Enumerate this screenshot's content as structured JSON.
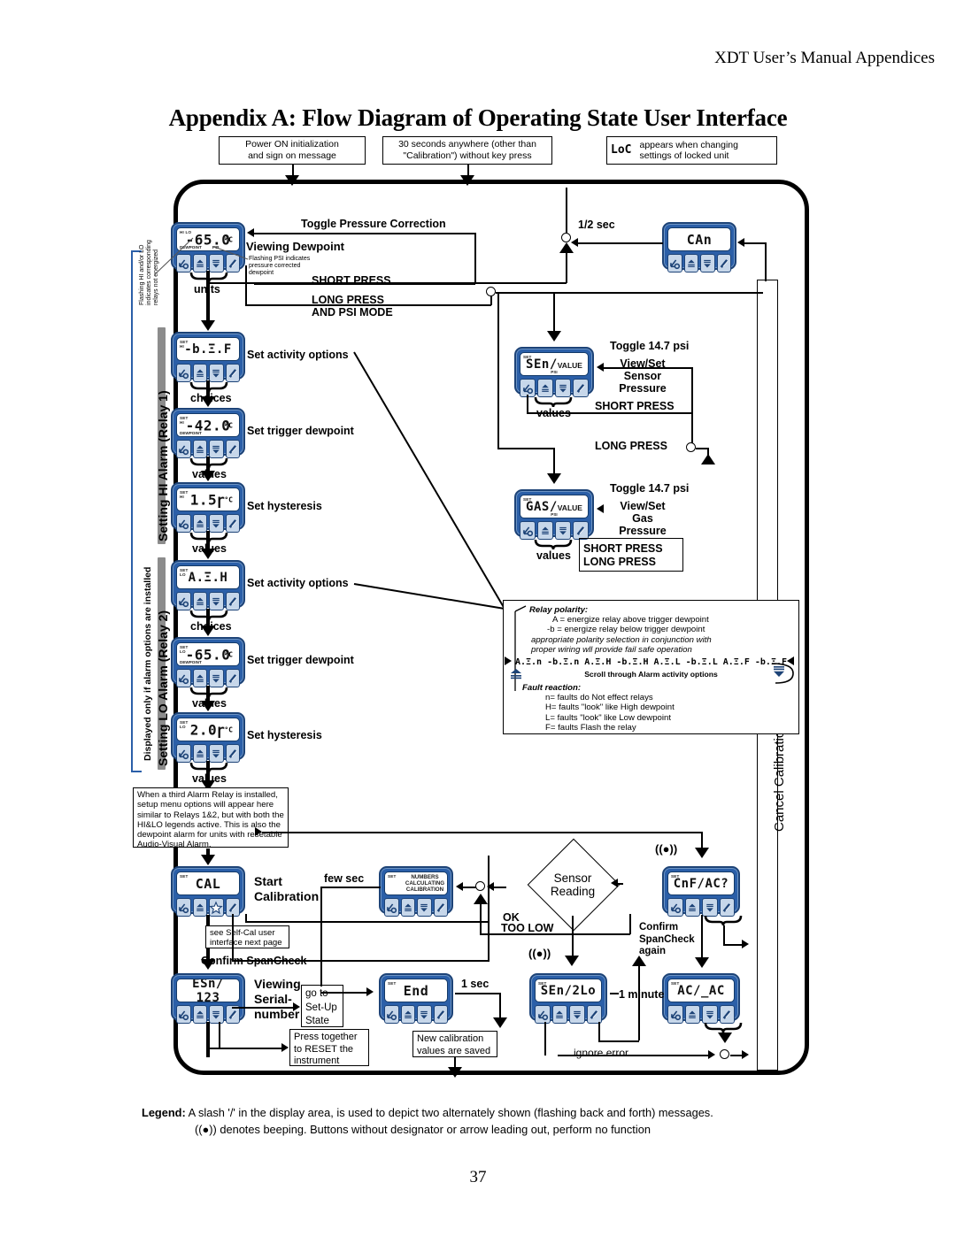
{
  "page": {
    "header": "XDT User’s Manual Appendices",
    "title": "Appendix A: Flow Diagram of Operating State User Interface",
    "number": "37"
  },
  "top_notes": {
    "power_on": "Power  ON initialization\nand sign on message",
    "timeout": "30 seconds anywhere (other than\n\"Calibration\") without key press",
    "locked_display": "LoC",
    "locked_text": "appears when changing\nsettings of locked unit"
  },
  "vertical_labels": {
    "installed": "Displayed only if alarm options are installed",
    "relay1": "Setting HI Alarm (Relay 1)",
    "relay2": "Setting LO Alarm (Relay 2)",
    "cancel_cal": "Cancel Calibration (it is not performed)",
    "flashing_note": "Flashing HI  and/or LO\nindicates corresponding\nrelays not energized"
  },
  "devices": {
    "dewpoint": {
      "tl": "HI LO",
      "bl": "DEWPOINT",
      "bc2": "PSI",
      "value": "-65.0",
      "unit": "°C"
    },
    "hi_activity": {
      "tl": "SET\nHI",
      "value": "-b.Ξ.F"
    },
    "hi_trigger": {
      "tl": "SET\nHI",
      "bl": "DEWPOINT",
      "value": "-42.0",
      "unit": "°C"
    },
    "hi_hyst": {
      "tl": "SET\nHI",
      "value": "1.5ɼ",
      "unit": "°C"
    },
    "lo_activity": {
      "tl": "SET\nLO",
      "value": "A.Ξ.H"
    },
    "lo_trigger": {
      "tl": "SET\nLO",
      "bl": "DEWPOINT",
      "value": "-65.0",
      "unit": "°C"
    },
    "lo_hyst": {
      "tl": "SET\nLO",
      "value": "2.0ɼ",
      "unit": "°C"
    },
    "can": {
      "value": "CAn"
    },
    "sen_value": {
      "tl": "SET",
      "bc": "PSI",
      "value": "SEn/",
      "suffix": "VALUE"
    },
    "gas_value": {
      "tl": "SET",
      "bc": "PSI",
      "value": "GAS/",
      "suffix": "VALUE"
    },
    "cal": {
      "tl": "SET",
      "value": "CAL"
    },
    "numbers": {
      "tl": "SET",
      "multi": "NUMBERS\nCALCULATING\nCALIBRATION"
    },
    "esn": {
      "value": "ESn/ 123"
    },
    "end": {
      "tl": "SET",
      "value": "End"
    },
    "sen2lo": {
      "tl": "SET",
      "value": "SEn/2Lo"
    },
    "cnf": {
      "tl": "SET",
      "value": "CnF/AC?"
    },
    "ac": {
      "tl": "SET",
      "value": "AC/_AC"
    }
  },
  "annotations": {
    "toggle_pressure": "Toggle Pressure Correction",
    "viewing_dewpoint": "Viewing Dewpoint",
    "flashing_psi": "Flashing PSI indicates\npressure corrected\ndewpoint",
    "short_press": "SHORT PRESS",
    "long_press_psi": "LONG PRESS\nAND PSI MODE",
    "units": "units",
    "choices": "choices",
    "values": "values",
    "set_activity": "Set activity options",
    "set_trigger": "Set trigger dewpoint",
    "set_hysteresis": "Set hysteresis",
    "half_sec": "1/2 sec",
    "toggle_147": "Toggle 14.7 psi",
    "view_set_sensor": "View/Set\nSensor\nPressure",
    "view_set_gas": "View/Set\nGas\nPressure",
    "long_press": "LONG PRESS",
    "third_relay": "When a third Alarm Relay is installed, setup menu options will appear here similar to Relays 1&2, but with both the HI&LO legends active. This is also the dewpoint alarm for units with resetable Audio-Visual Alarm.",
    "start_calibration": "Start\nCalibration",
    "self_cal": "see Self-Cal user\ninterface next page",
    "confirm_spancheck": "Confirm SpanCheck",
    "confirm_spancheck_again": "Confirm\nSpanCheck\nagain",
    "few_sec": "few sec",
    "ok": "OK",
    "too_low": "TOO LOW",
    "sensor_reading": "Sensor\nReading",
    "viewing_serial": "Viewing\nSerial-\nnumber",
    "goto_setup": "go to\nSet-Up\nState",
    "press_reset": "Press together\nto RESET the\ninstrument",
    "one_sec": "1 sec",
    "new_cal_saved": "New calibration\nvalues are saved",
    "one_minute": "1 minute",
    "ignore_error": "ignore error"
  },
  "relay_legend": {
    "polarity_title": "Relay polarity:",
    "polarity_a": "A = energize relay above trigger dewpoint",
    "polarity_b": "-b = energize relay below trigger dewpoint",
    "polarity_note": "appropriate polarity selection in conjunction with\nproper wiring wll provide fail safe operation",
    "options": "A.Ξ.n  -b.Ξ.n  A.Ξ.H  -b.Ξ.H  A.Ξ.L  -b.Ξ.L  A.Ξ.F  -b.Ξ.F",
    "scroll": "Scroll through Alarm  activity options",
    "fault_title": "Fault reaction:",
    "fault_n": "n= faults do Not effect relays",
    "fault_h": "H= faults \"look\" like High dewpoint",
    "fault_l": "L= faults \"look\" like Low dewpoint",
    "fault_f": "F= faults Flash the relay"
  },
  "legend": {
    "line1_bold": "Legend:",
    "line1": " A slash '/' in the display area, is used to depict two alternately shown (flashing back and forth) messages.",
    "line2": "denotes beeping.  Buttons without designator or arrow leading out, perform no function"
  },
  "colors": {
    "device_blue": "#2b5fa8",
    "button_face": "#c7d7ea",
    "band_gray": "#8c8c8c"
  }
}
